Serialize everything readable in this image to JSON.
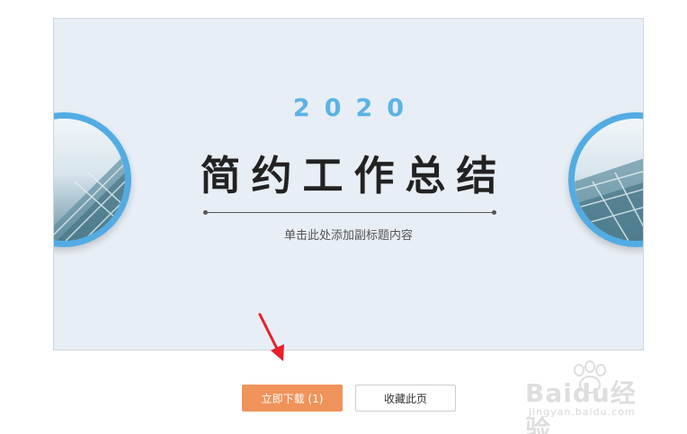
{
  "slide": {
    "year": "2020",
    "title": "简约工作总结",
    "subtitle": "单击此处添加副标题内容"
  },
  "actions": {
    "download_label": "立即下载 (1)",
    "favorite_label": "收藏此页"
  },
  "watermark": {
    "logo": "Baidu经验",
    "url": "jingyan.baidu.com"
  },
  "colors": {
    "accent_blue": "#5bb3e6",
    "download_button": "#f0935a",
    "arrow": "#e8202a",
    "slide_background": "#e8eef5"
  },
  "icons": [
    "red-arrow-icon",
    "building-photo"
  ]
}
